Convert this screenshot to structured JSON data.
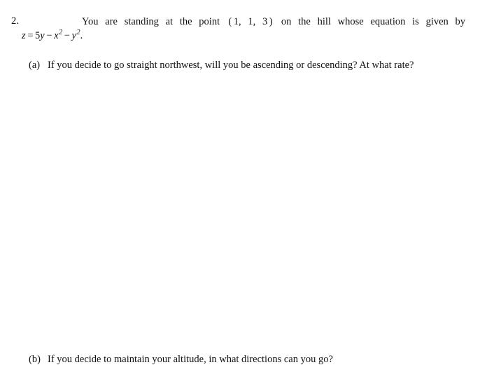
{
  "document": {
    "type": "math-homework-problem",
    "background_color": "#ffffff",
    "text_color": "#111114"
  },
  "problem": {
    "number": "2.",
    "stem": {
      "text_before_math": "You are standing at the point",
      "point": {
        "open": "(",
        "x": "1",
        "sep1": ",",
        "y": "1",
        "sep2": ",",
        "z": "3",
        "close": ")",
        "rendered": "(1, 1, 3)"
      },
      "text_after_math": "on the hill whose equation is given by",
      "full_line": "You are standing at the point (1, 1, 3) on the hill whose equation is given by"
    },
    "equation": {
      "lhs": "z",
      "relation": "=",
      "term1_coefficient": "5",
      "term1_variable": "y",
      "operator1": "−",
      "term2_variable": "x",
      "term2_exponent": "2",
      "operator2": "−",
      "term3_variable": "y",
      "term3_exponent": "2",
      "terminator": ".",
      "rendered": "z = 5y − x² − y²."
    },
    "parts": [
      {
        "label": "(a)",
        "text": "If you decide to go straight northwest, will you be ascending or descending?  At what rate?"
      },
      {
        "label": "(b)",
        "text": "If you decide to maintain your altitude, in what directions can you go?"
      }
    ]
  }
}
